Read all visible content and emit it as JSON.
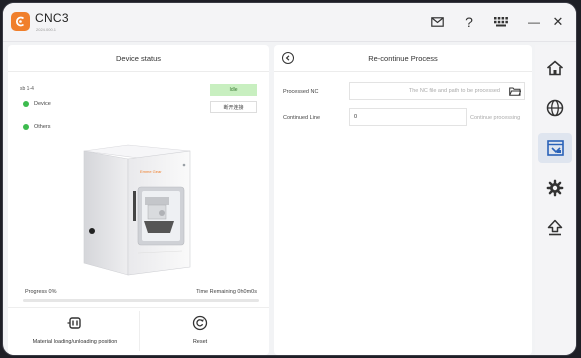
{
  "app": {
    "title": "CNC3",
    "subtitle": "2024.000.1"
  },
  "titlebar": {
    "icons": [
      "mail-icon",
      "help-icon",
      "keyboard-icon",
      "minimize-icon",
      "close-icon"
    ],
    "help_glyph": "?",
    "minimize_glyph": "—",
    "close_glyph": "✕"
  },
  "device_status": {
    "header": "Device status",
    "model": "sb 1-4",
    "items": [
      {
        "label": "Device",
        "status_color": "#3dbb4e"
      },
      {
        "label": "Others",
        "status_color": "#3dbb4e"
      }
    ],
    "state_badge": "Idle",
    "disconnect_label": "断开连接",
    "machine_brand": "Emme Gear",
    "progress_label": "Progress 0%",
    "progress_value": 0,
    "time_remaining": "Time Remaining 0h0m0s",
    "actions": [
      {
        "label": "Material loading/unloading position",
        "icon": "material-position-icon"
      },
      {
        "label": "Reset",
        "icon": "reset-icon"
      }
    ]
  },
  "recontinue": {
    "header": "Re-continue Process",
    "processed_nc_label": "Processed NC",
    "processed_nc_placeholder": "The NC file and path to be processed",
    "continued_line_label": "Continued Line",
    "continued_line_value": "0",
    "continue_button": "Continue processing"
  },
  "sidebar": {
    "items": [
      {
        "name": "home",
        "icon": "home-icon",
        "active": false
      },
      {
        "name": "globe",
        "icon": "globe-icon",
        "active": false
      },
      {
        "name": "recontinue",
        "icon": "recontinue-icon",
        "active": true
      },
      {
        "name": "settings",
        "icon": "gear-icon",
        "active": false
      },
      {
        "name": "upgrade",
        "icon": "upload-icon",
        "active": false
      }
    ]
  },
  "colors": {
    "accent": "#f07f2b",
    "status_green": "#3dbb4e",
    "idle_badge_bg": "#c8efc0",
    "active_nav_bg": "#dfe5ef",
    "window_bg": "#f2f3f5"
  }
}
